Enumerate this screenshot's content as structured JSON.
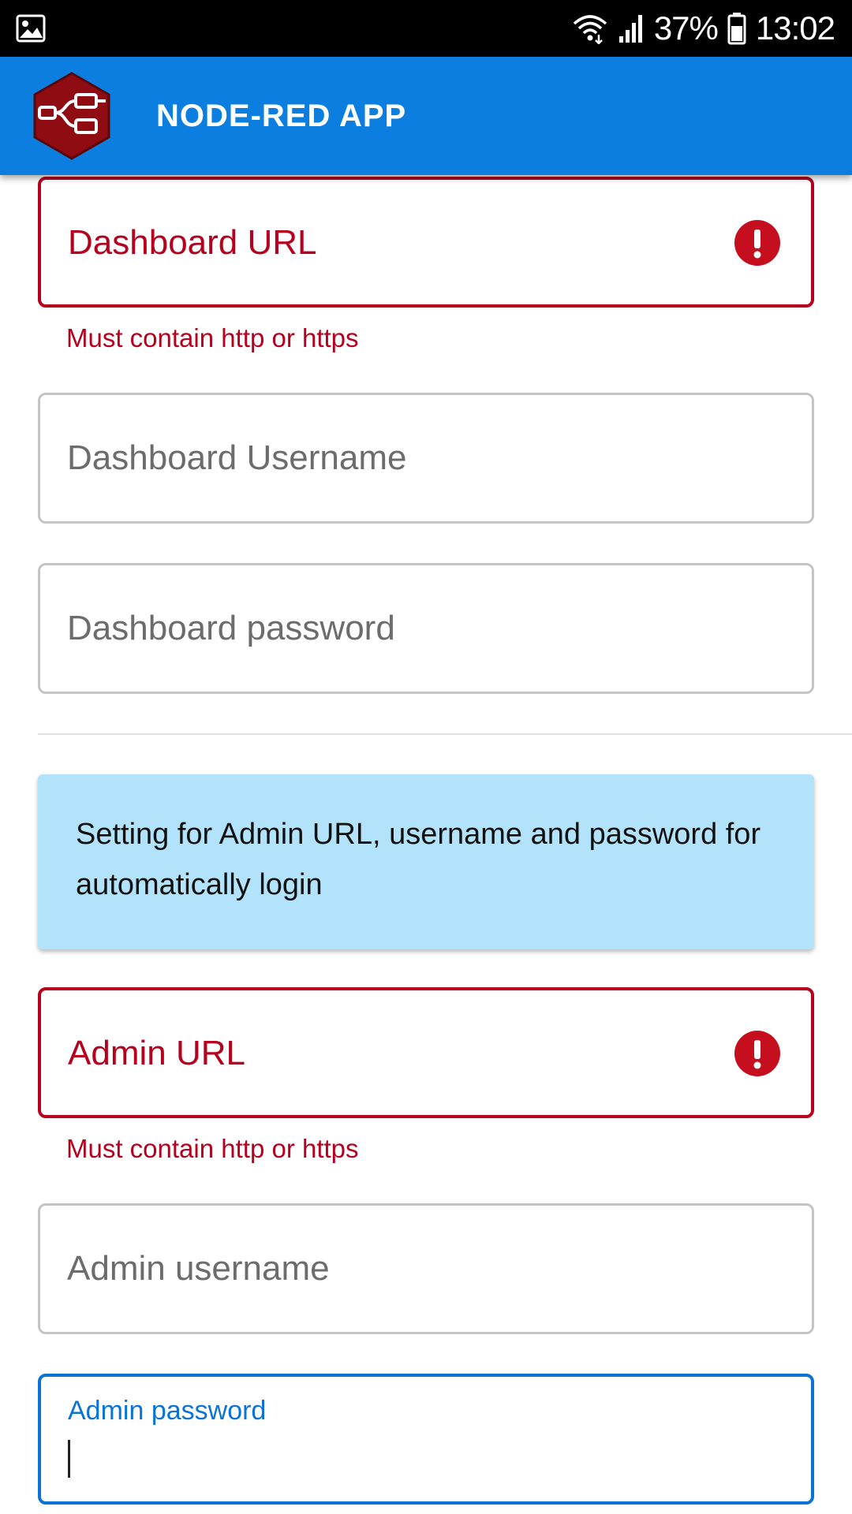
{
  "status_bar": {
    "battery_percent": "37%",
    "time": "13:02",
    "icons": [
      "image-icon",
      "wifi-icon",
      "signal-icon",
      "battery-icon"
    ]
  },
  "app_bar": {
    "title": "NODE-RED APP",
    "logo_icon": "node-red-logo-icon",
    "color": "#0b7ee0"
  },
  "form": {
    "dashboard_url": {
      "label": "Dashboard URL",
      "error": "Must contain http or https"
    },
    "dashboard_username": {
      "label": "Dashboard Username"
    },
    "dashboard_password": {
      "label": "Dashboard password"
    },
    "info_box": {
      "text": "Setting for Admin URL, username and password for automatically login"
    },
    "admin_url": {
      "label": "Admin URL",
      "error": "Must contain http or https"
    },
    "admin_username": {
      "label": "Admin username"
    },
    "admin_password": {
      "label": "Admin password",
      "value": ""
    }
  },
  "colors": {
    "error": "#b5001e",
    "focus": "#0b73d6",
    "info_background": "#b3e3fa"
  }
}
